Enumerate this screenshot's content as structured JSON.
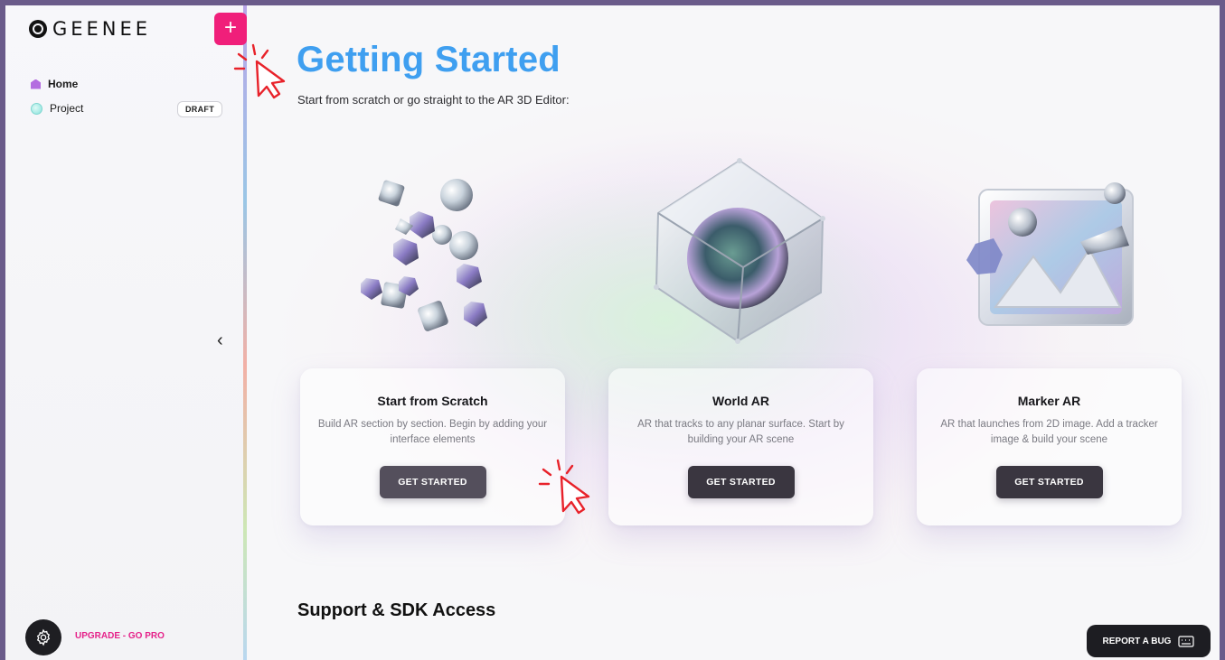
{
  "sidebar": {
    "logo_text": "GEENEE",
    "add_label": "+",
    "items": [
      {
        "label": "Home"
      },
      {
        "label": "Project",
        "badge": "DRAFT"
      }
    ],
    "collapse_label": "‹",
    "upgrade_label": "UPGRADE - GO PRO"
  },
  "header": {
    "title": "Getting Started",
    "subtitle": "Start from scratch or go straight to the AR 3D Editor:"
  },
  "cards": [
    {
      "title": "Start from Scratch",
      "description": "Build AR section by section. Begin by adding your interface elements",
      "button": "GET STARTED",
      "illustration": "floating-shapes-icon"
    },
    {
      "title": "World AR",
      "description": "AR that tracks to any planar surface. Start by building your AR scene",
      "button": "GET STARTED",
      "illustration": "glass-cube-icon"
    },
    {
      "title": "Marker AR",
      "description": "AR that launches from 2D image. Add a tracker image & build your scene",
      "button": "GET STARTED",
      "illustration": "image-frame-icon"
    }
  ],
  "support": {
    "title": "Support & SDK Access"
  },
  "report_button": "REPORT A BUG",
  "colors": {
    "brand_pink": "#f01f7a",
    "title_blue": "#3f9ff0",
    "button_dark": "#3a3640",
    "cursor_red": "#e8222a"
  }
}
